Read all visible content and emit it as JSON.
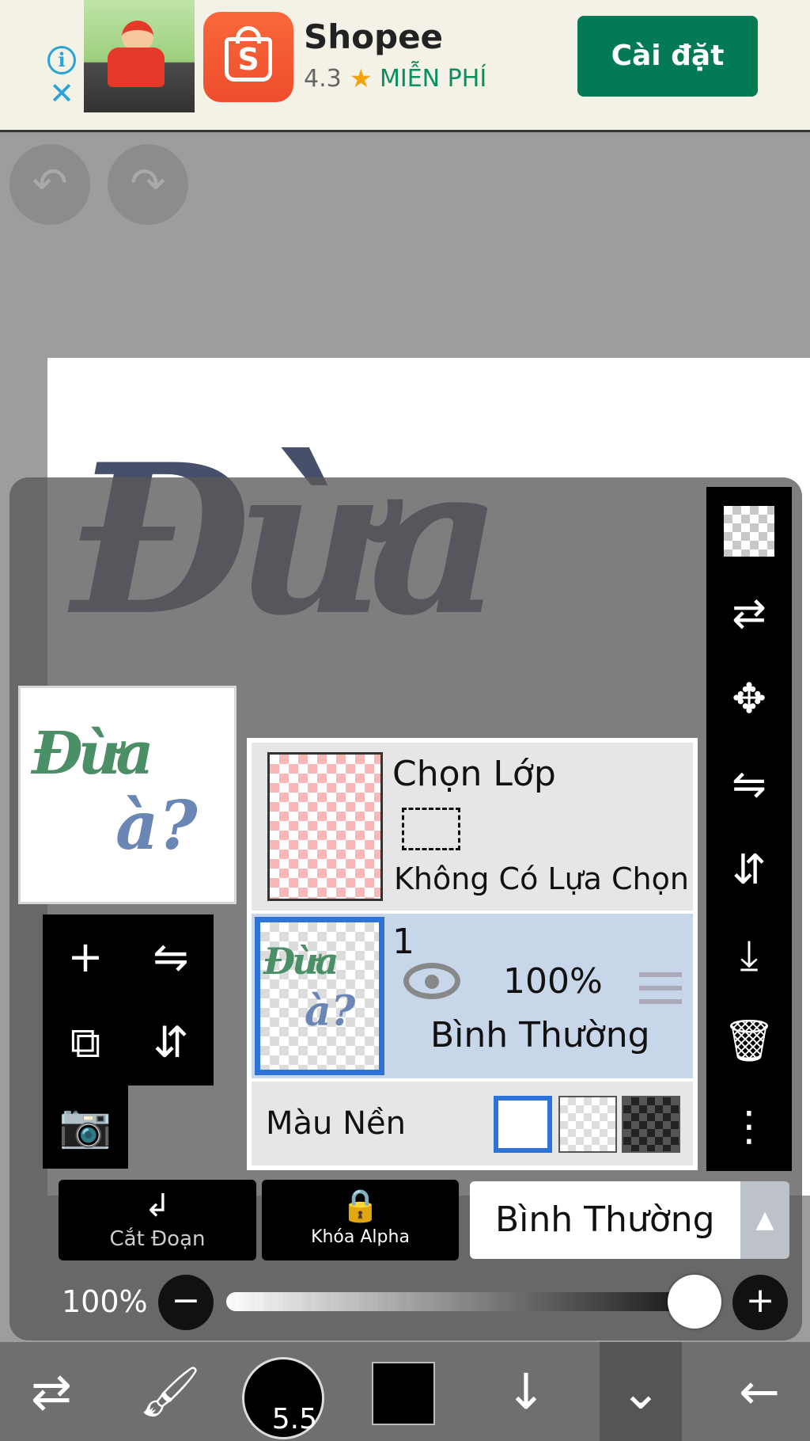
{
  "ad": {
    "app_name": "Shopee",
    "rating": "4.3",
    "star": "★",
    "price": "MIỄN PHÍ",
    "install_label": "Cài đặt",
    "info_glyph": "i",
    "close_glyph": "✕",
    "logo_letter": "S",
    "brand_color": "#ee4d2d",
    "install_color": "#017a55"
  },
  "toolbar_top": {
    "undo_icon": "undo-icon",
    "redo_icon": "redo-icon"
  },
  "canvas": {
    "art_text": "Đừa",
    "preview_line1": "Đừa",
    "preview_line2": "à?"
  },
  "right_tools": [
    {
      "icon": "transparency-checker-icon"
    },
    {
      "icon": "swap-layer-icon"
    },
    {
      "icon": "move-icon"
    },
    {
      "icon": "flip-horizontal-icon"
    },
    {
      "icon": "flip-vertical-icon"
    },
    {
      "icon": "merge-down-icon"
    },
    {
      "icon": "trash-icon"
    },
    {
      "icon": "more-icon"
    }
  ],
  "left_tools": [
    {
      "icon": "add-layer-icon"
    },
    {
      "icon": "flip-horizontal-icon"
    },
    {
      "icon": "duplicate-layer-icon"
    },
    {
      "icon": "flip-vertical-icon"
    },
    {
      "icon": "camera-icon"
    }
  ],
  "layers": {
    "selection_layer": {
      "title": "Chọn Lớp",
      "subtitle": "Không Có Lựa Chọn"
    },
    "layer_1": {
      "number": "1",
      "opacity": "100%",
      "blend_mode": "Bình Thường",
      "visible": true
    },
    "background": {
      "label": "Màu Nền",
      "options": [
        "white",
        "transparent",
        "dark"
      ],
      "selected": "white"
    }
  },
  "controls": {
    "clipping_label": "Cắt Đoạn",
    "alpha_lock_label": "Khóa Alpha",
    "blend_mode_value": "Bình Thường",
    "opacity_label": "100%",
    "opacity_value": 1.0,
    "minus": "−",
    "plus": "+",
    "dropdown_arrow": "▲"
  },
  "bottom_bar": {
    "brush_size": "5.5",
    "current_color": "#000000",
    "items": [
      "tool-switch-icon",
      "brush-icon",
      "brush-size",
      "color",
      "down-arrow-icon",
      "layers-collapse-icon",
      "back-arrow-icon"
    ]
  }
}
